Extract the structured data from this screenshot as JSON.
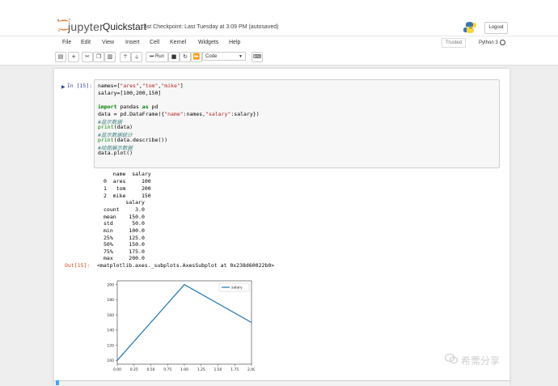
{
  "header": {
    "logo_text": "jupyter",
    "notebook_name": "Quickstart",
    "checkpoint": "Last Checkpoint: Last Tuesday at 3:09 PM  (autosaved)",
    "logout_label": "Logout"
  },
  "menubar": {
    "items": [
      "File",
      "Edit",
      "View",
      "Insert",
      "Cell",
      "Kernel",
      "Widgets",
      "Help"
    ],
    "trusted_label": "Trusted",
    "kernel_name": "Python 3"
  },
  "toolbar": {
    "run_label": "Run",
    "cell_type": "Code"
  },
  "cell": {
    "in_prompt": "In [15]:",
    "code_lines": [
      "names=[\"ares\",\"tom\",\"mike\"]",
      "salary=[100,200,150]",
      "",
      "import pandas as pd",
      "data = pd.DataFrame({\"name\":names,\"salary\":salary})",
      "#显示数据",
      "print(data)",
      "#显示数据统计",
      "print(data.describe())",
      "#绘图展示数据",
      "data.plot()"
    ],
    "stdout_lines": [
      "   name  salary",
      "0  ares     100",
      "1   tom     200",
      "2  mike     150",
      "       salary",
      "count     3.0",
      "mean    150.0",
      "std      50.0",
      "min     100.0",
      "25%     125.0",
      "50%     150.0",
      "75%     175.0",
      "max     200.0"
    ],
    "out_prompt": "Out[15]:",
    "out_result": "<matplotlib.axes._subplots.AxesSubplot at 0x238d60022b0>"
  },
  "chart_data": {
    "type": "line",
    "x": [
      0,
      1,
      2
    ],
    "series": [
      {
        "name": "salary",
        "values": [
          100,
          200,
          150
        ]
      }
    ],
    "xticks": [
      "0.00",
      "0.25",
      "0.50",
      "0.75",
      "1.00",
      "1.25",
      "1.50",
      "1.75",
      "2.00"
    ],
    "yticks": [
      "100",
      "120",
      "140",
      "160",
      "180",
      "200"
    ],
    "xlim": [
      0,
      2
    ],
    "ylim": [
      95,
      205
    ],
    "legend": "upper-right",
    "line_color": "#1f77b4"
  },
  "watermark": "希薷分享"
}
